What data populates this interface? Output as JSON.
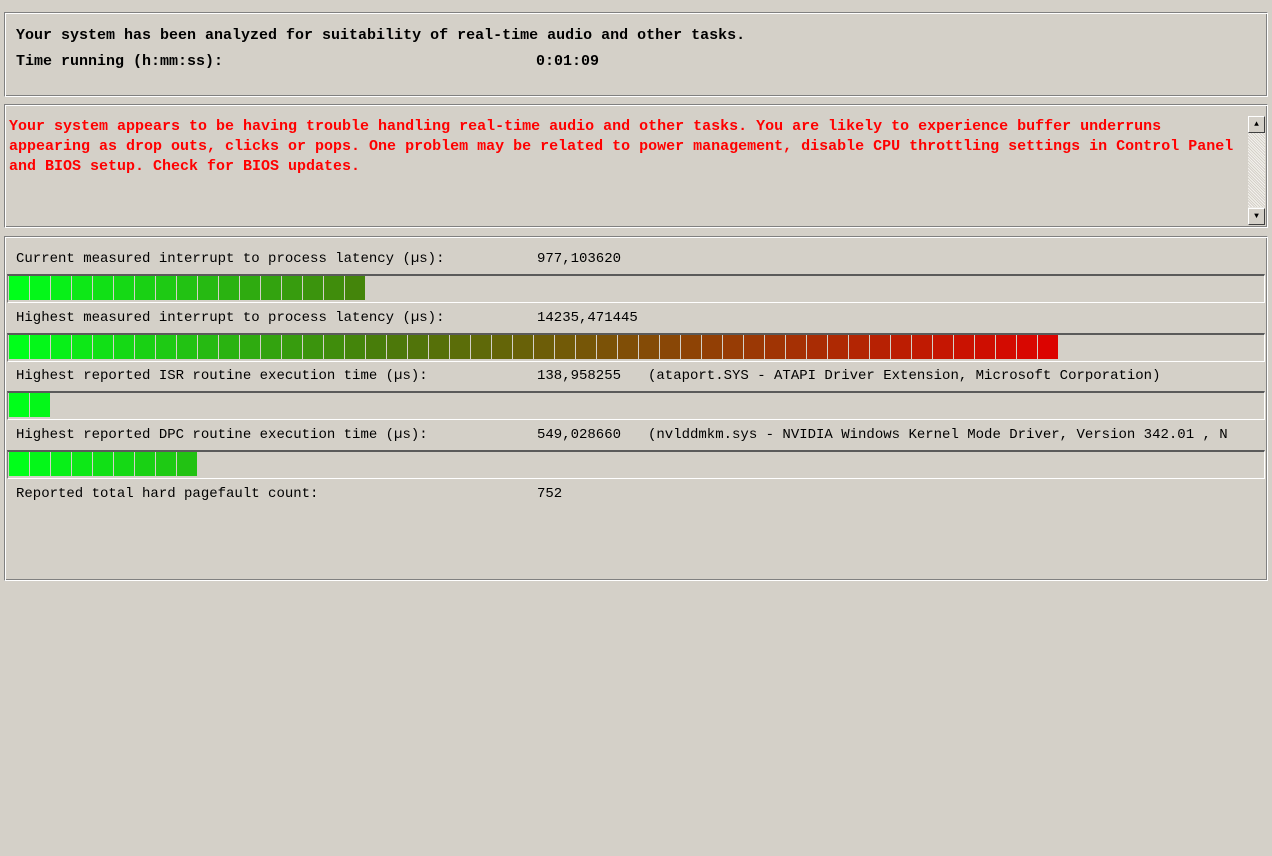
{
  "summary": {
    "line1": "Your system has been analyzed for suitability of real-time audio and other tasks.",
    "time_label": "Time running (h:mm:ss):",
    "time_value": "0:01:09"
  },
  "message": {
    "text": "Your system appears to be having trouble handling real-time audio and other tasks. You are likely to experience buffer underruns appearing as drop outs, clicks or pops. One problem may be related to power management, disable CPU throttling settings in Control Panel and BIOS setup. Check for BIOS updates.",
    "color": "#ff0000"
  },
  "metrics": {
    "current": {
      "label": "Current measured interrupt to process latency (µs):",
      "value": "977,103620",
      "bar_segments": 17
    },
    "highest": {
      "label": "Highest measured interrupt to process latency (µs):",
      "value": "14235,471445",
      "bar_segments": 50
    },
    "isr": {
      "label": "Highest reported ISR routine execution time (µs):",
      "value": "138,958255",
      "driver": "(ataport.SYS - ATAPI Driver Extension, Microsoft Corporation)",
      "bar_segments": 2
    },
    "dpc": {
      "label": "Highest reported DPC routine execution time (µs):",
      "value": "549,028660",
      "driver": "(nvlddmkm.sys - NVIDIA Windows Kernel Mode Driver, Version 342.01 , N",
      "bar_segments": 9
    },
    "pagefault": {
      "label": "Reported total hard pagefault count:",
      "value": "752"
    }
  },
  "bar_scale_total_segments": 60,
  "colors": {
    "bar_start": "#00ff1a",
    "bar_mid": "#4a7a0a",
    "bar_end": "#e00000",
    "background": "#d4d0c8"
  }
}
